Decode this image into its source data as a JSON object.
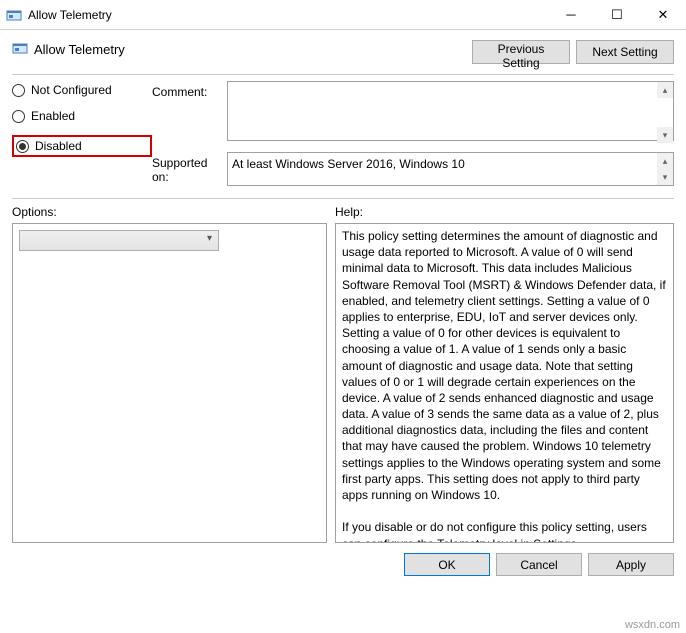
{
  "window": {
    "title": "Allow Telemetry"
  },
  "header": {
    "title": "Allow Telemetry",
    "prev": "Previous Setting",
    "next": "Next Setting"
  },
  "state": {
    "options": [
      "Not Configured",
      "Enabled",
      "Disabled"
    ],
    "selected": 2
  },
  "comment": {
    "label": "Comment:",
    "value": ""
  },
  "supported": {
    "label": "Supported on:",
    "value": "At least Windows Server 2016, Windows 10"
  },
  "sections": {
    "options": "Options:",
    "help": "Help:"
  },
  "help": {
    "p1": "This policy setting determines the amount of diagnostic and usage data reported to Microsoft. A value of 0 will send minimal data to Microsoft. This data includes Malicious Software Removal Tool (MSRT) & Windows Defender data, if enabled, and telemetry client settings. Setting a value of 0 applies to enterprise, EDU, IoT and server devices only. Setting a value of 0 for other devices is equivalent to choosing a value of 1. A value of 1 sends only a basic amount of diagnostic and usage data. Note that setting values of 0 or 1 will degrade certain experiences on the device. A value of 2 sends enhanced diagnostic and usage data. A value of 3 sends the same data as a value of 2, plus additional diagnostics data, including the files and content that may have caused the problem. Windows 10 telemetry settings applies to the Windows operating system and some first party apps. This setting does not apply to third party apps running on Windows 10.",
    "p2": "If you disable or do not configure this policy setting, users can configure the Telemetry level in Settings."
  },
  "footer": {
    "ok": "OK",
    "cancel": "Cancel",
    "apply": "Apply"
  },
  "watermark": "wsxdn.com"
}
